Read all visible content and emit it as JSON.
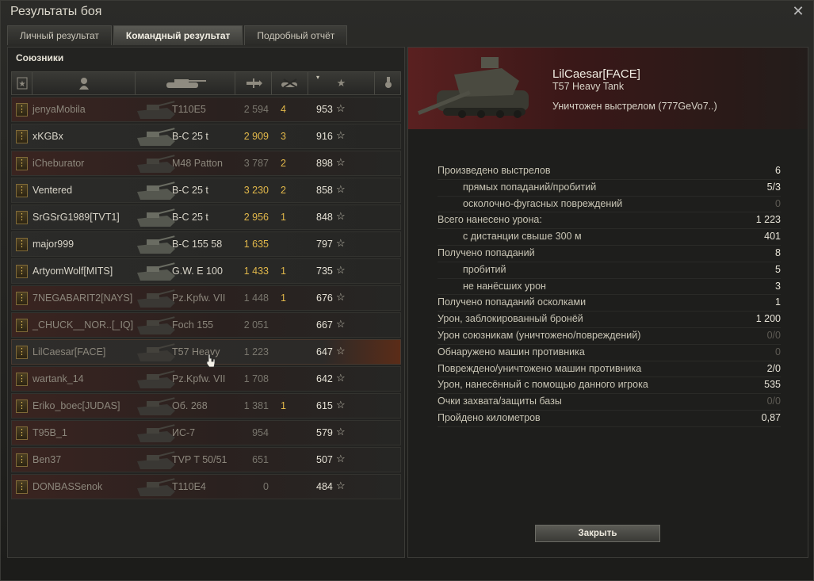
{
  "window": {
    "title": "Результаты боя"
  },
  "tabs": [
    {
      "label": "Личный результат",
      "active": false
    },
    {
      "label": "Командный результат",
      "active": true
    },
    {
      "label": "Подробный отчёт",
      "active": false
    }
  ],
  "team": {
    "title": "Союзники",
    "columns": [
      "rank-icon",
      "player-icon",
      "tank-icon",
      "damage-icon",
      "kills-icon",
      "xp-icon",
      "medal-icon"
    ],
    "players": [
      {
        "name": "jenyaMobila",
        "tank": "T110E5",
        "damage": "2 594",
        "kills": "4",
        "xp": "953",
        "dead": true
      },
      {
        "name": "xKGBx",
        "tank": "B-C 25 t",
        "damage": "2 909",
        "kills": "3",
        "xp": "916",
        "dead": false
      },
      {
        "name": "iCheburator",
        "tank": "M48 Patton",
        "damage": "3 787",
        "kills": "2",
        "xp": "898",
        "dead": true
      },
      {
        "name": "Ventered",
        "tank": "B-C 25 t",
        "damage": "3 230",
        "kills": "2",
        "xp": "858",
        "dead": false
      },
      {
        "name": "SrGSrG1989[TVT1]",
        "tank": "B-C 25 t",
        "damage": "2 956",
        "kills": "1",
        "xp": "848",
        "dead": false
      },
      {
        "name": "major999",
        "tank": "B-C 155 58",
        "damage": "1 635",
        "kills": "",
        "xp": "797",
        "dead": false
      },
      {
        "name": "ArtyomWolf[MITS]",
        "tank": "G.W. E 100",
        "damage": "1 433",
        "kills": "1",
        "xp": "735",
        "dead": false
      },
      {
        "name": "7NEGABARIT2[NAYS]",
        "tank": "Pz.Kpfw. VII",
        "damage": "1 448",
        "kills": "1",
        "xp": "676",
        "dead": true
      },
      {
        "name": "_CHUCK__NOR..[_IQ]",
        "tank": "Foch 155",
        "damage": "2 051",
        "kills": "",
        "xp": "667",
        "dead": true
      },
      {
        "name": "LilCaesar[FACE]",
        "tank": "T57 Heavy",
        "damage": "1 223",
        "kills": "",
        "xp": "647",
        "dead": true,
        "selected": true
      },
      {
        "name": "wartank_14",
        "tank": "Pz.Kpfw. VII",
        "damage": "1 708",
        "kills": "",
        "xp": "642",
        "dead": true
      },
      {
        "name": "Eriko_boec[JUDAS]",
        "tank": "Об. 268",
        "damage": "1 381",
        "kills": "1",
        "xp": "615",
        "dead": true
      },
      {
        "name": "T95B_1",
        "tank": "ИС-7",
        "damage": "954",
        "kills": "",
        "xp": "579",
        "dead": true
      },
      {
        "name": "Ben37",
        "tank": "TVP T 50/51",
        "damage": "651",
        "kills": "",
        "xp": "507",
        "dead": true
      },
      {
        "name": "DONBASSenok",
        "tank": "T110E4",
        "damage": "0",
        "kills": "",
        "xp": "484",
        "dead": true
      }
    ]
  },
  "detail": {
    "player_name": "LilCaesar[FACE]",
    "tank_name": "T57 Heavy Tank",
    "death": "Уничтожен выстрелом (777GeVo7..)",
    "stats": [
      {
        "label": "Произведено выстрелов",
        "value": "6",
        "sub": false
      },
      {
        "label": "прямых попаданий/пробитий",
        "value": "5/3",
        "sub": true
      },
      {
        "label": "осколочно-фугасных повреждений",
        "value": "0",
        "sub": true,
        "dim": true
      },
      {
        "label": "Всего нанесено урона:",
        "value": "1 223",
        "sub": false
      },
      {
        "label": "с дистанции свыше 300 м",
        "value": "401",
        "sub": true
      },
      {
        "label": "Получено попаданий",
        "value": "8",
        "sub": false
      },
      {
        "label": "пробитий",
        "value": "5",
        "sub": true
      },
      {
        "label": "не нанёсших урон",
        "value": "3",
        "sub": true
      },
      {
        "label": "Получено попаданий осколками",
        "value": "1",
        "sub": false
      },
      {
        "label": "Урон, заблокированный бронёй",
        "value": "1 200",
        "sub": false
      },
      {
        "label": "Урон союзникам (уничтожено/повреждений)",
        "value": "0/0",
        "sub": false,
        "dim": true
      },
      {
        "label": "Обнаружено машин противника",
        "value": "0",
        "sub": false,
        "dim": true
      },
      {
        "label": "Повреждено/уничтожено машин противника",
        "value": "2/0",
        "sub": false,
        "partdim": true
      },
      {
        "label": "Урон, нанесённый с помощью данного игрока",
        "value": "535",
        "sub": false
      },
      {
        "label": "Очки захвата/защиты базы",
        "value": "0/0",
        "sub": false,
        "dim": true
      },
      {
        "label": "Пройдено километров",
        "value": "0,87",
        "sub": false
      }
    ],
    "close_label": "Закрыть"
  },
  "colors": {
    "accent_gold": "#e2b84a",
    "dead_row": "#3a2420",
    "selected_glow": "#5b2c18"
  }
}
